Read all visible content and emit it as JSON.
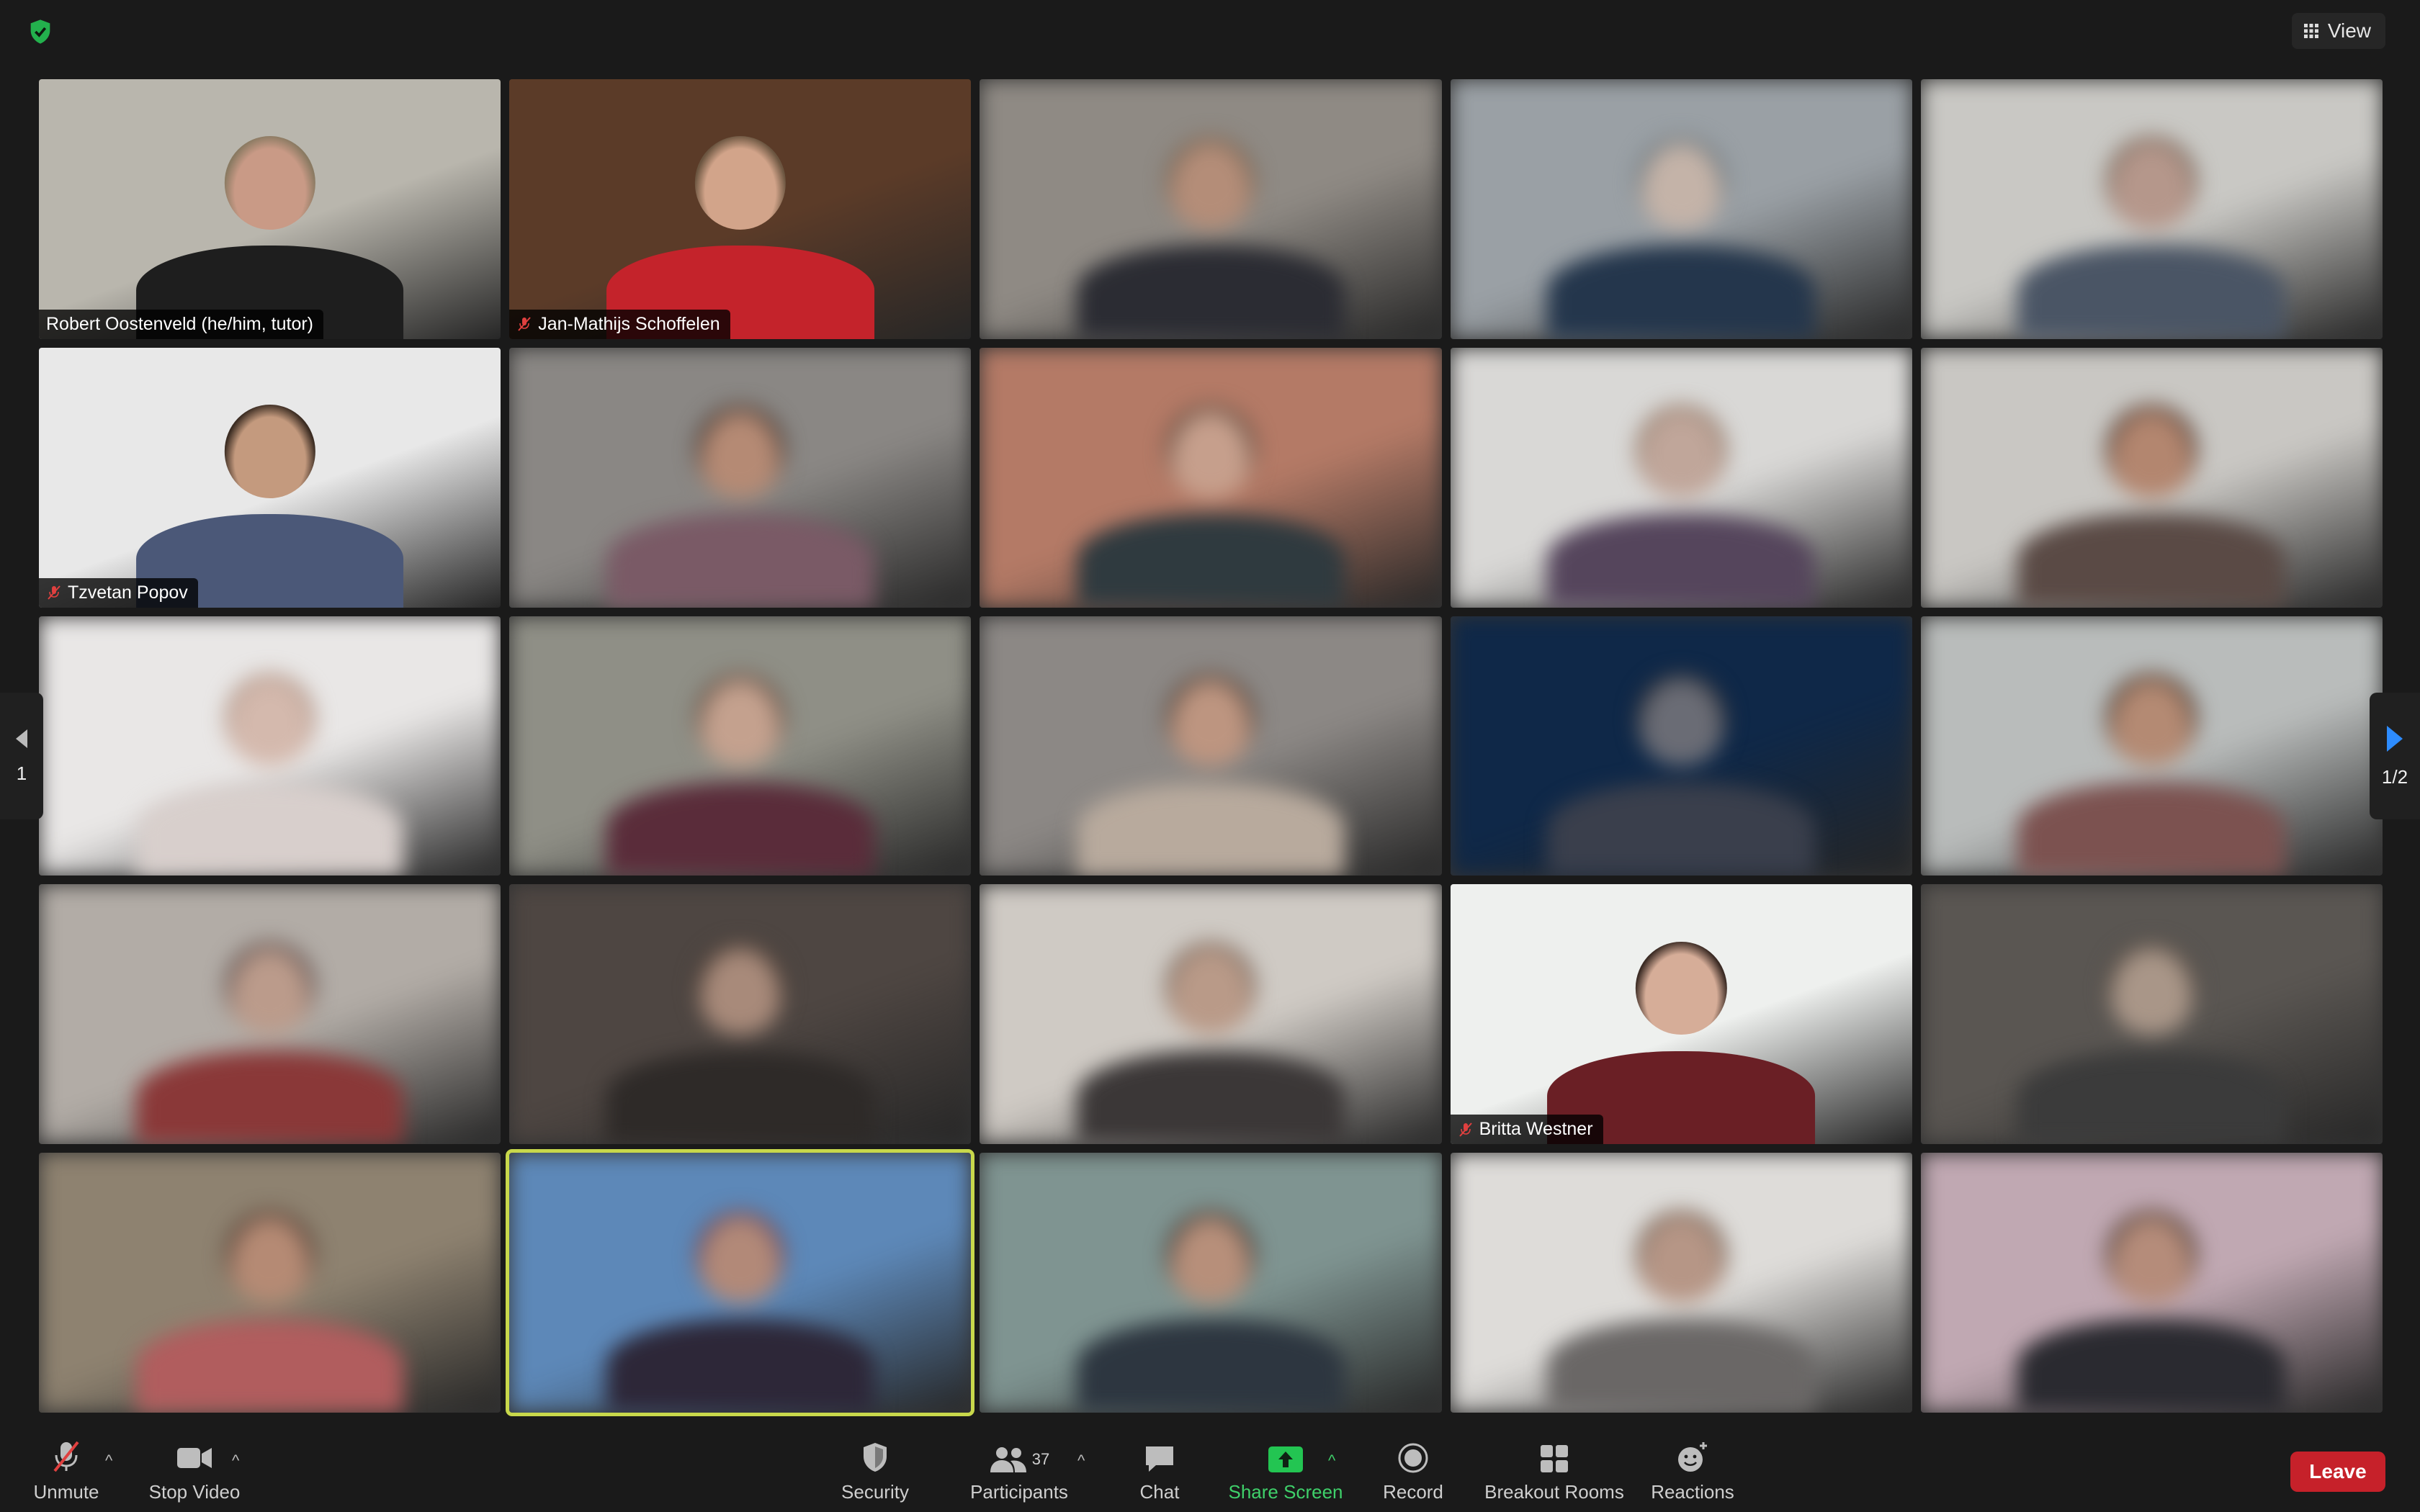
{
  "topbar": {
    "security_icon": "shield-check-icon",
    "view_label": "View"
  },
  "pagination": {
    "prev_label": "1",
    "next_label": "1/2"
  },
  "tiles": [
    {
      "name": "Robert Oostenveld (he/him, tutor)",
      "muted": false,
      "blurred": false,
      "bg": "#b9b6ad",
      "skin": "#c99a86",
      "shirt": "#1e1e1e",
      "hair": "#8a7a62"
    },
    {
      "name": "Jan-Mathijs Schoffelen",
      "muted": true,
      "blurred": false,
      "bg": "#5b3b28",
      "skin": "#d2a48a",
      "shirt": "#c4232b",
      "hair": "#6b5540"
    },
    {
      "name": "",
      "muted": false,
      "blurred": true,
      "bg": "#8f8a84",
      "skin": "#b48d78",
      "shirt": "#2b2c33",
      "hair": "#6a5b4a"
    },
    {
      "name": "",
      "muted": false,
      "blurred": true,
      "bg": "#9aa0a5",
      "skin": "#c4b3a8",
      "shirt": "#24364c",
      "hair": "#5a6a73"
    },
    {
      "name": "",
      "muted": false,
      "blurred": true,
      "bg": "#c9c8c4",
      "skin": "#b5978b",
      "shirt": "#4a5565",
      "hair": "#6f5f52"
    },
    {
      "name": "Tzvetan Popov",
      "muted": true,
      "blurred": false,
      "bg": "#e8e8e8",
      "skin": "#c49a7e",
      "shirt": "#4b5878",
      "hair": "#3b2c22"
    },
    {
      "name": "",
      "muted": false,
      "blurred": true,
      "bg": "#8a8784",
      "skin": "#b58a74",
      "shirt": "#7a5a66",
      "hair": "#2f2622"
    },
    {
      "name": "",
      "muted": false,
      "blurred": true,
      "bg": "#b47a66",
      "skin": "#c69f8c",
      "shirt": "#2f3a3f",
      "hair": "#4a3a30"
    },
    {
      "name": "",
      "muted": false,
      "blurred": true,
      "bg": "#d9d8d6",
      "skin": "#c0a69a",
      "shirt": "#55455c",
      "hair": "#8b7564"
    },
    {
      "name": "",
      "muted": false,
      "blurred": true,
      "bg": "#c9c7c3",
      "skin": "#b3866f",
      "shirt": "#5a4a45",
      "hair": "#3e2c24"
    },
    {
      "name": "",
      "muted": false,
      "blurred": true,
      "bg": "#e9e7e6",
      "skin": "#d4b9ad",
      "shirt": "#d8cfcc",
      "hair": "#a88e80"
    },
    {
      "name": "",
      "muted": false,
      "blurred": true,
      "bg": "#8f8f86",
      "skin": "#c4a18e",
      "shirt": "#5a2c3a",
      "hair": "#4d3b30"
    },
    {
      "name": "",
      "muted": false,
      "blurred": true,
      "bg": "#8c8885",
      "skin": "#bd9580",
      "shirt": "#b8aa9d",
      "hair": "#3f322a"
    },
    {
      "name": "",
      "muted": false,
      "blurred": true,
      "bg": "#0f2848",
      "skin": "#6a6c75",
      "shirt": "#3a3f4c",
      "hair": "#2d2d33"
    },
    {
      "name": "",
      "muted": false,
      "blurred": true,
      "bg": "#b9bcbb",
      "skin": "#b48a73",
      "shirt": "#7c5250",
      "hair": "#3a2a20"
    },
    {
      "name": "",
      "muted": false,
      "blurred": true,
      "bg": "#b2aca6",
      "skin": "#bb9b8b",
      "shirt": "#8a3838",
      "hair": "#45393a"
    },
    {
      "name": "",
      "muted": false,
      "blurred": true,
      "bg": "#4e4642",
      "skin": "#a88a7a",
      "shirt": "#2e2a28",
      "hair": "#3a302a"
    },
    {
      "name": "",
      "muted": false,
      "blurred": true,
      "bg": "#cfcac4",
      "skin": "#b99a88",
      "shirt": "#3b3737",
      "hair": "#6e5f55"
    },
    {
      "name": "Britta Westner",
      "muted": true,
      "blurred": false,
      "bg": "#eef0ee",
      "skin": "#d6ad98",
      "shirt": "#6a1f25",
      "hair": "#3b2b24"
    },
    {
      "name": "",
      "muted": false,
      "blurred": true,
      "bg": "#5a5652",
      "skin": "#a99688",
      "shirt": "#3b3b3b",
      "hair": "#4a413a"
    },
    {
      "name": "",
      "muted": false,
      "blurred": true,
      "bg": "#8e8270",
      "skin": "#b58a74",
      "shirt": "#b15d5e",
      "hair": "#3b2c24"
    },
    {
      "name": "",
      "muted": false,
      "blurred": true,
      "bg": "#5d88b8",
      "skin": "#b28978",
      "shirt": "#2d2738",
      "hair": "#5a3a55"
    },
    {
      "name": "",
      "muted": false,
      "blurred": true,
      "bg": "#7f9491",
      "skin": "#b78f7a",
      "shirt": "#2d3640",
      "hair": "#2c2a28"
    },
    {
      "name": "",
      "muted": false,
      "blurred": true,
      "bg": "#dedcd9",
      "skin": "#b69686",
      "shirt": "#6a6766",
      "hair": "#6a5a4e"
    },
    {
      "name": "",
      "muted": false,
      "blurred": true,
      "bg": "#c0a8b2",
      "skin": "#b58c7a",
      "shirt": "#2a2a30",
      "hair": "#3a2e28"
    }
  ],
  "active_tile": 21,
  "toolbar": {
    "unmute_label": "Unmute",
    "stop_video_label": "Stop Video",
    "security_label": "Security",
    "participants_label": "Participants",
    "participants_count": "37",
    "chat_label": "Chat",
    "share_screen_label": "Share Screen",
    "record_label": "Record",
    "breakout_label": "Breakout Rooms",
    "reactions_label": "Reactions",
    "leave_label": "Leave"
  },
  "colors": {
    "share_green": "#3fd06a",
    "leave_red": "#c6212a",
    "active_speaker": "#c8d84b"
  }
}
